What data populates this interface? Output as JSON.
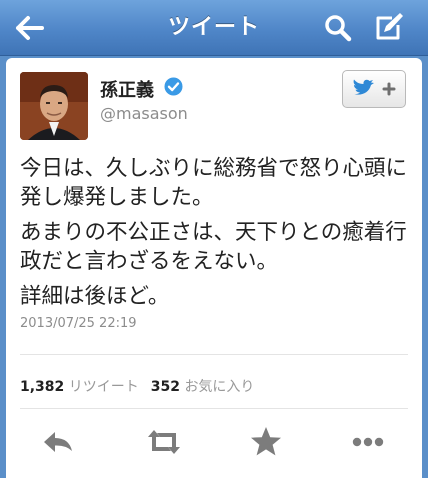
{
  "navbar": {
    "title": "ツイート"
  },
  "tweet": {
    "display_name": "孫正義",
    "screen_name": "@masason",
    "verified": true,
    "paragraphs": [
      "今日は、久しぶりに総務省で怒り心頭に発し爆発しました。",
      "あまりの不公正さは、天下りとの癒着行政だと言わざるをえない。",
      "詳細は後ほど。"
    ],
    "timestamp": "2013/07/25 22:19",
    "retweet_count": "1,382",
    "retweet_label": "リツイート",
    "favorite_count": "352",
    "favorite_label": "お気に入り"
  },
  "colors": {
    "navbar": "#4f86c8",
    "twitter_blue": "#3a8fd6",
    "action_gray": "#7c7c7c"
  },
  "icons": {
    "back": "back-arrow-icon",
    "search": "search-icon",
    "compose": "compose-icon",
    "follow": "twitter-bird-plus-icon",
    "reply": "reply-icon",
    "retweet": "retweet-icon",
    "favorite": "star-icon",
    "more": "more-icon"
  }
}
